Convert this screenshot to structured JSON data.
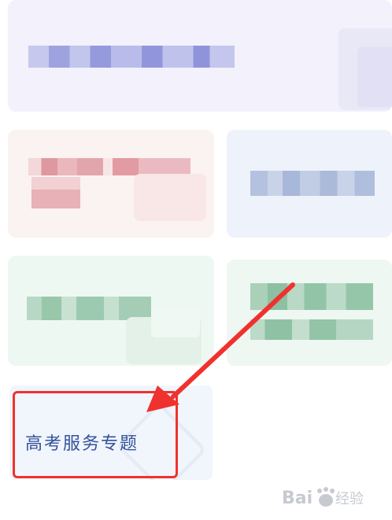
{
  "cards": {
    "service": {
      "title": "高考服务专题"
    }
  },
  "colors": {
    "highlight_red": "#f0322e",
    "title_blue": "#34539b"
  },
  "watermark": {
    "text": "Bai 经验"
  }
}
